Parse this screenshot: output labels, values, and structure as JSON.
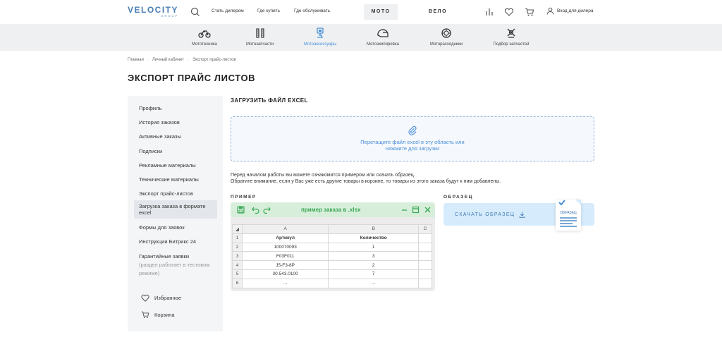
{
  "header": {
    "logo": "VELOCITY",
    "logo_sub": "GROUP",
    "links": [
      "Стать дилером",
      "Где купить",
      "Где обслуживать"
    ],
    "tabs": [
      "МОТО",
      "ВЕЛО"
    ],
    "dealer_login": "Вход для дилера"
  },
  "categories": [
    "Мототехника",
    "Мотозапчасти",
    "Мотоаксессуары",
    "Мотоэкипировка",
    "Моторасходники",
    "Подбор запчастей"
  ],
  "breadcrumbs": [
    "Главная",
    "Личный кабинет",
    "Экспорт прайс-листов"
  ],
  "page_title": "ЭКСПОРТ ПРАЙС ЛИСТОВ",
  "sidebar": {
    "items": [
      "Профиль",
      "История заказов",
      "Активные заказы",
      "Подписки",
      "Рекламные материалы",
      "Технические материалы",
      "Экспорт прайс-листов",
      "Загрузка заказа в формате excel",
      "Формы для заявок",
      "Инструкции Битрикс 24",
      "Гарантийные заявки"
    ],
    "warranty_note": "(раздел работает в тестовом режиме)",
    "favorites": "Избранное",
    "cart": "Корзина"
  },
  "upload": {
    "title": "ЗАГРУЗИТЬ ФАЙЛ EXCEL",
    "drop_line1": "Перетащите файл excel в эту область или",
    "drop_line2": "нажмите для загрузки"
  },
  "note": {
    "line1": "Перед началом работы вы можете ознакомится примером или скачать образец.",
    "line2": "Обратите внимание, если у Вас уже есть другие товары в корзине, то товары из этого заказа будут к ним добавлены."
  },
  "example": {
    "label": "ПРИМЕР",
    "filename": "пример заказа в .xlsx",
    "columns": [
      "A",
      "B",
      "C"
    ],
    "rows": [
      [
        "1",
        "Артикул",
        "Количество",
        ""
      ],
      [
        "2",
        "100070093",
        "1",
        ""
      ],
      [
        "3",
        "F03F011",
        "3",
        ""
      ],
      [
        "4",
        "J5-F3-8P",
        "2",
        ""
      ],
      [
        "5",
        "30.543.0100",
        "7",
        ""
      ],
      [
        "6",
        "...",
        "...",
        ""
      ]
    ]
  },
  "sample": {
    "label": "ОБРАЗЕЦ",
    "button": "СКАЧАТЬ ОБРАЗЕЦ",
    "doc_label": "ОБРАЗЕЦ"
  },
  "colors": {
    "accent": "#4a8fd9",
    "excel_green": "#3aa655",
    "sidebar_bg": "#f3f5f7"
  }
}
